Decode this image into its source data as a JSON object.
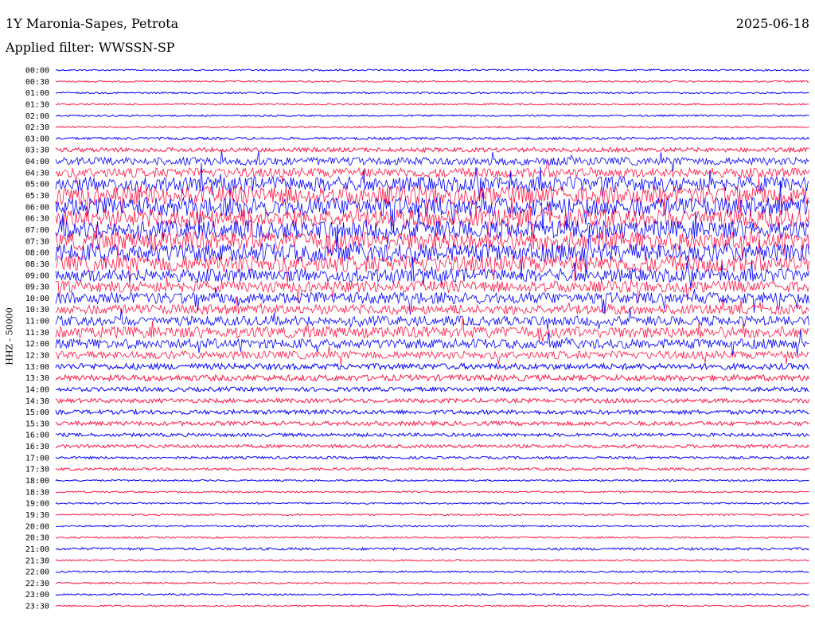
{
  "header": {
    "station": "1Y Maronia-Sapes, Petrota",
    "date": "2025-06-18",
    "filter": "Applied filter: WWSSN-SP"
  },
  "channel_label": "HHZ - 50000",
  "colors": {
    "trace_a": "#0000ff",
    "trace_b": "#ff1744",
    "background": "#ffffff"
  },
  "chart_data": {
    "type": "line",
    "title": "1Y Maronia-Sapes, Petrota",
    "ylabel": "HHZ - 50000",
    "grid": false,
    "rows": [
      "00:00",
      "00:30",
      "01:00",
      "01:30",
      "02:00",
      "02:30",
      "03:00",
      "03:30",
      "04:00",
      "04:30",
      "05:00",
      "05:30",
      "06:00",
      "06:30",
      "07:00",
      "07:30",
      "08:00",
      "08:30",
      "09:00",
      "09:30",
      "10:00",
      "10:30",
      "11:00",
      "11:30",
      "12:00",
      "12:30",
      "13:00",
      "13:30",
      "14:00",
      "14:30",
      "15:00",
      "15:30",
      "16:00",
      "16:30",
      "17:00",
      "17:30",
      "18:00",
      "18:30",
      "19:00",
      "19:30",
      "20:00",
      "20:30",
      "21:00",
      "21:30",
      "22:00",
      "22:30",
      "23:00",
      "23:30"
    ],
    "row_colors": [
      "#0000ff",
      "#ff1744"
    ],
    "row_activity": [
      0.05,
      0.05,
      0.05,
      0.05,
      0.05,
      0.05,
      0.1,
      0.2,
      0.4,
      0.5,
      0.8,
      1.0,
      1.0,
      1.0,
      1.0,
      1.0,
      1.0,
      0.9,
      0.7,
      0.6,
      0.6,
      0.5,
      0.5,
      0.6,
      0.5,
      0.4,
      0.3,
      0.3,
      0.2,
      0.2,
      0.2,
      0.2,
      0.15,
      0.15,
      0.1,
      0.1,
      0.05,
      0.05,
      0.05,
      0.05,
      0.05,
      0.05,
      0.1,
      0.05,
      0.05,
      0.05,
      0.05,
      0.05
    ]
  }
}
